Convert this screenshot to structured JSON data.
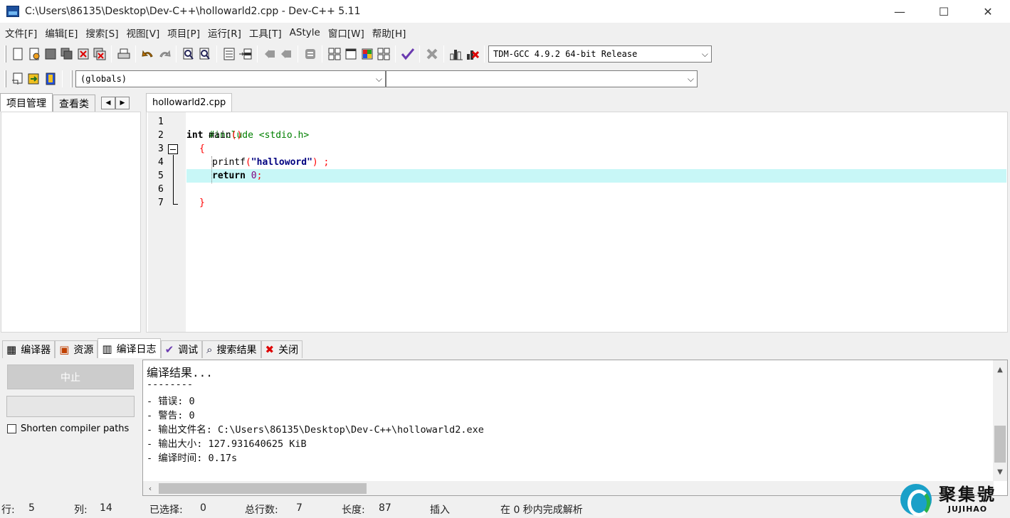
{
  "window": {
    "title": "C:\\Users\\86135\\Desktop\\Dev-C++\\hollowarld2.cpp - Dev-C++ 5.11",
    "minimize": "—",
    "maximize": "☐",
    "close": "✕"
  },
  "menu": [
    "文件[F]",
    "编辑[E]",
    "搜索[S]",
    "视图[V]",
    "项目[P]",
    "运行[R]",
    "工具[T]",
    "AStyle",
    "窗口[W]",
    "帮助[H]"
  ],
  "toolbar": {
    "compiler_select": "TDM-GCC 4.9.2 64-bit Release",
    "globals_select": "(globals)",
    "function_select": ""
  },
  "left_tabs": [
    "项目管理",
    "查看类"
  ],
  "editor": {
    "file_tab": "hollowarld2.cpp",
    "line_numbers": [
      "1",
      "2",
      "3",
      "4",
      "5",
      "6",
      "7"
    ],
    "lines": {
      "l1": "#include <stdio.h>",
      "l2_kw": "int",
      "l2_rest": " main",
      "l2_paren": "()",
      "l3": "{",
      "l4_fn": "printf",
      "l4_open": "(",
      "l4_str": "\"halloword\"",
      "l4_close": ")",
      "l4_semi": " ;",
      "l5_kw": "return",
      "l5_num": " 0",
      "l5_semi": ";",
      "l7": "}"
    },
    "current_line_highlight": "#c8f7f7"
  },
  "bottom_tabs": [
    {
      "icon": "▦",
      "label": "编译器"
    },
    {
      "icon": "▣",
      "label": "资源"
    },
    {
      "icon": "▥",
      "label": "编译日志"
    },
    {
      "icon": "✔",
      "label": "调试"
    },
    {
      "icon": "⌕",
      "label": "搜索结果"
    },
    {
      "icon": "✖",
      "label": "关闭"
    }
  ],
  "compile_panel": {
    "stop_button": "中止",
    "shorten_paths_label": "Shorten compiler paths"
  },
  "log": [
    "编译结果...",
    "--------",
    "- 错误: 0",
    "- 警告: 0",
    "- 输出文件名: C:\\Users\\86135\\Desktop\\Dev-C++\\hollowarld2.exe",
    "- 输出大小: 127.931640625 KiB",
    "- 编译时间: 0.17s"
  ],
  "status": {
    "row_label": "行:",
    "row_value": "5",
    "col_label": "列:",
    "col_value": "14",
    "sel_label": "已选择:",
    "sel_value": "0",
    "lines_label": "总行数:",
    "lines_value": "7",
    "len_label": "长度:",
    "len_value": "87",
    "mode": "插入",
    "parse": "在 0 秒内完成解析"
  },
  "watermark": {
    "cn": "聚集號",
    "en": "JUJIHAO"
  }
}
